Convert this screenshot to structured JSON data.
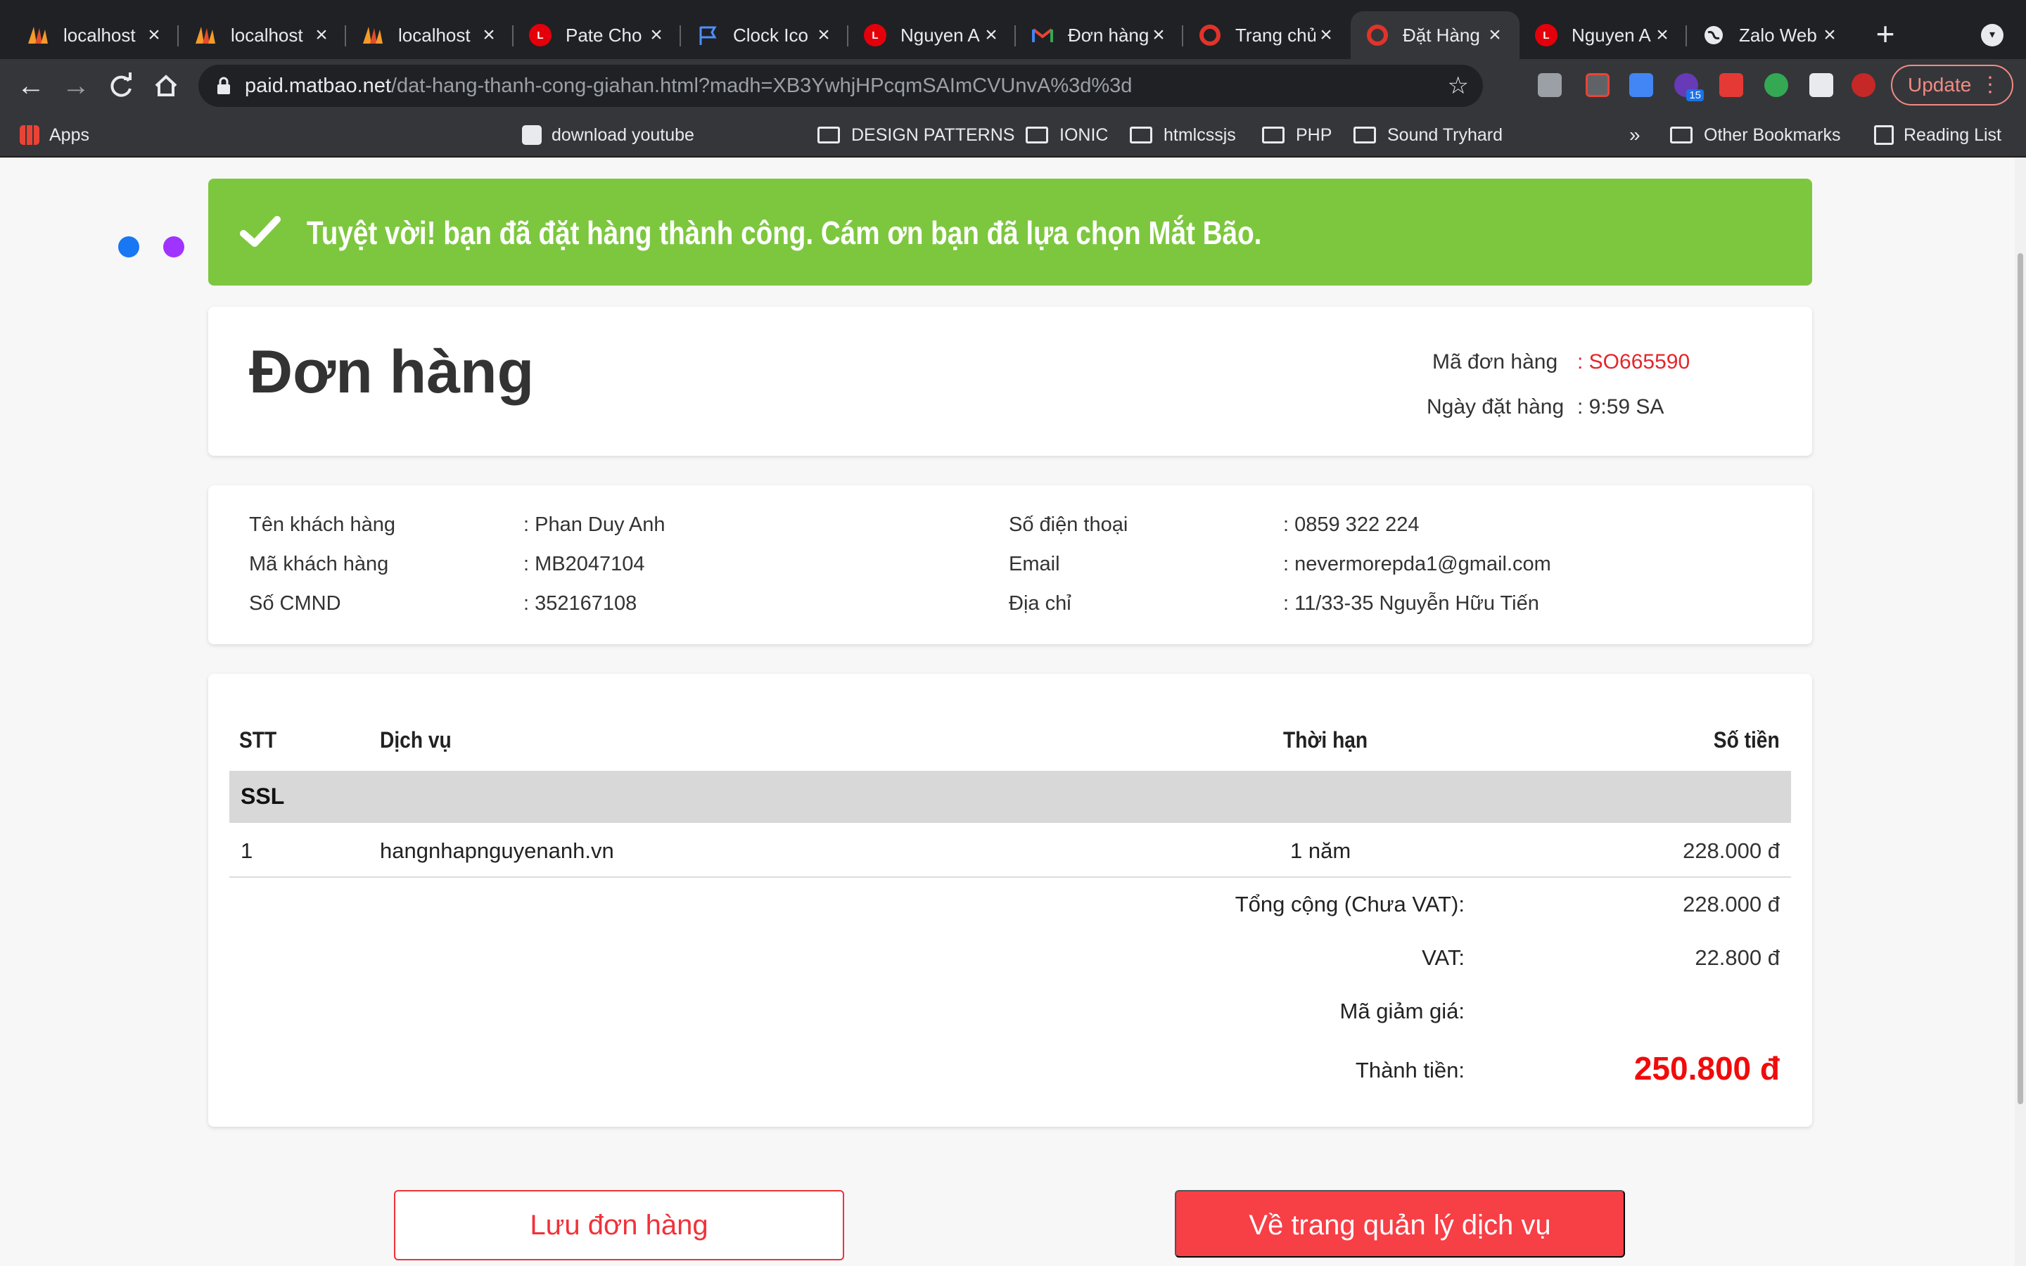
{
  "browser": {
    "tabs": [
      {
        "title": "localhost",
        "icon": "localhost-logo-icon"
      },
      {
        "title": "localhost",
        "icon": "localhost-logo-icon"
      },
      {
        "title": "localhost",
        "icon": "localhost-logo-icon"
      },
      {
        "title": "Pate Cho",
        "icon": "lego-logo-icon"
      },
      {
        "title": "Clock Ico",
        "icon": "flag-icon"
      },
      {
        "title": "Nguyen A",
        "icon": "lego-logo-icon"
      },
      {
        "title": "Đơn hàng",
        "icon": "gmail-icon"
      },
      {
        "title": "Trang chủ",
        "icon": "opera-icon"
      },
      {
        "title": "Đặt Hàng",
        "icon": "opera-icon",
        "active": true
      },
      {
        "title": "Nguyen A",
        "icon": "lego-logo-icon"
      },
      {
        "title": "Zalo Web",
        "icon": "globe-icon"
      }
    ],
    "new_tab": "+",
    "url_host": "paid.matbao.net",
    "url_path": "/dat-hang-thanh-cong-giahan.html?madh=XB3YwhjHPcqmSAImCVUnvA%3d%3d",
    "extension_badge": "15",
    "update_label": "Update",
    "bookmarks": {
      "apps": "Apps",
      "download_youtube": "download youtube",
      "design_patterns": "DESIGN PATTERNS",
      "ionic": "IONIC",
      "htmlcssjs": "htmlcssjs",
      "php": "PHP",
      "sound_tryhard": "Sound Tryhard",
      "more": "»",
      "other": "Other Bookmarks",
      "reading_list": "Reading List"
    },
    "colors": {
      "tabbar": "#202124",
      "toolbar": "#35363a",
      "update": "#f28b82"
    }
  },
  "page": {
    "success_message": "Tuyệt vời! bạn đã đặt hàng thành công. Cám ơn bạn đã lựa chọn Mắt Bão.",
    "order": {
      "title": "Đơn hàng",
      "code_label": "Mã đơn hàng",
      "code_value": ": SO665590",
      "date_label": "Ngày đặt hàng",
      "date_value": ": 9:59 SA"
    },
    "customer": {
      "name_label": "Tên khách hàng",
      "name_value": ": Phan Duy Anh",
      "id_label": "Mã khách hàng",
      "id_value": ": MB2047104",
      "cmnd_label": "Số CMND",
      "cmnd_value": ": 352167108",
      "phone_label": "Số điện thoại",
      "phone_value": ": 0859 322 224",
      "email_label": "Email",
      "email_value": ": nevermorepda1@gmail.com",
      "address_label": "Địa chỉ",
      "address_value": ": 11/33-35 Nguyễn Hữu Tiến"
    },
    "table": {
      "headers": {
        "stt": "STT",
        "service": "Dịch vụ",
        "term": "Thời hạn",
        "amount": "Số tiền"
      },
      "group": "SSL",
      "rows": [
        {
          "stt": "1",
          "service": "hangnhapnguyenanh.vn",
          "term": "1 năm",
          "amount": "228.000 đ"
        }
      ],
      "subtotal_label": "Tổng cộng (Chưa VAT):",
      "subtotal_value": "228.000 đ",
      "vat_label": "VAT:",
      "vat_value": "22.800 đ",
      "discount_label": "Mã giảm giá:",
      "discount_value": "",
      "total_label": "Thành tiền:",
      "total_value": "250.800 đ"
    },
    "buttons": {
      "save": "Lưu đơn hàng",
      "manage": "Về trang quản lý dịch vụ"
    },
    "colors": {
      "success": "#7dc73f",
      "accent": "#f0323a",
      "total": "#f10b0b"
    }
  }
}
